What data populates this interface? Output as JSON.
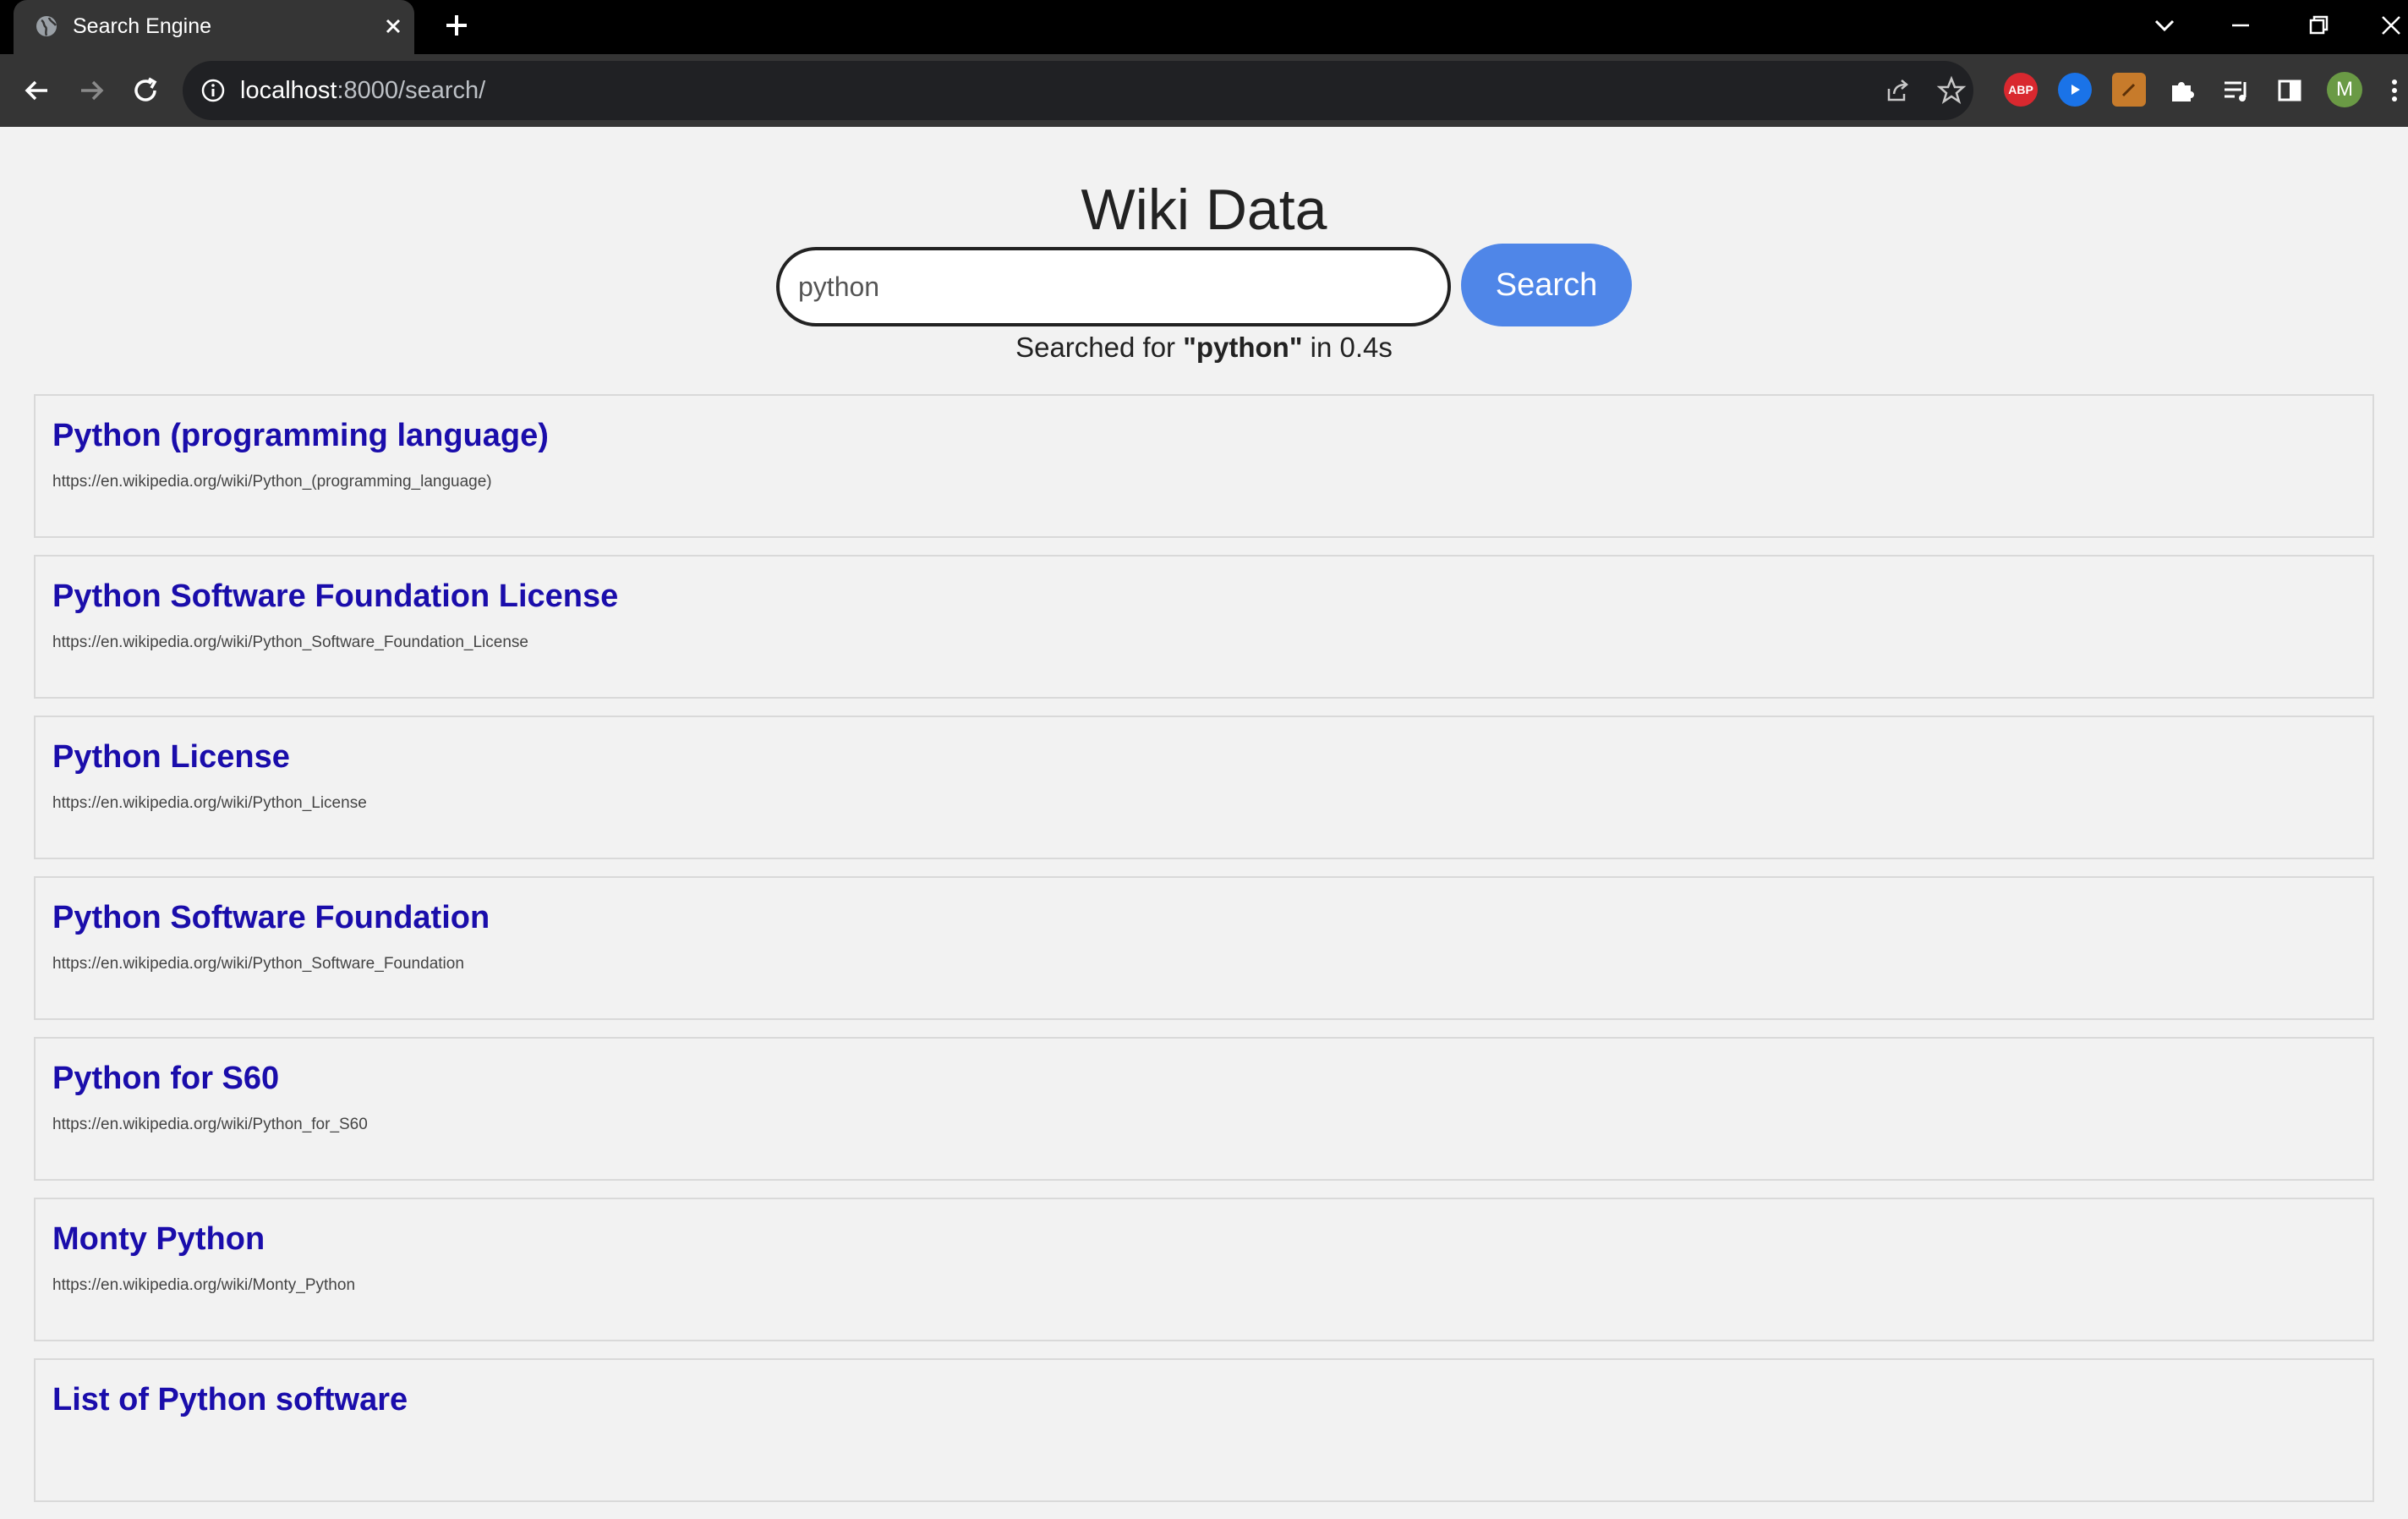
{
  "browser": {
    "tab": {
      "title": "Search Engine"
    },
    "url": {
      "host": "localhost",
      "path": ":8000/search/"
    },
    "extensions": [
      {
        "name": "adblock",
        "label": "ABP",
        "color": "#d9282f"
      },
      {
        "name": "video-extension",
        "label": "",
        "color": "#1a73e8"
      },
      {
        "name": "notes-extension",
        "label": "",
        "color": "#c77b2b"
      }
    ],
    "avatar_initial": "M"
  },
  "page": {
    "title": "Wiki Data",
    "search": {
      "value": "python",
      "button_label": "Search",
      "status_prefix": "Searched for ",
      "status_query": "\"python\"",
      "status_suffix": " in 0.4s"
    },
    "results": [
      {
        "title": "Python (programming language)",
        "url": "https://en.wikipedia.org/wiki/Python_(programming_language)"
      },
      {
        "title": "Python Software Foundation License",
        "url": "https://en.wikipedia.org/wiki/Python_Software_Foundation_License"
      },
      {
        "title": "Python License",
        "url": "https://en.wikipedia.org/wiki/Python_License"
      },
      {
        "title": "Python Software Foundation",
        "url": "https://en.wikipedia.org/wiki/Python_Software_Foundation"
      },
      {
        "title": "Python for S60",
        "url": "https://en.wikipedia.org/wiki/Python_for_S60"
      },
      {
        "title": "Monty Python",
        "url": "https://en.wikipedia.org/wiki/Monty_Python"
      },
      {
        "title": "List of Python software",
        "url": ""
      }
    ]
  }
}
